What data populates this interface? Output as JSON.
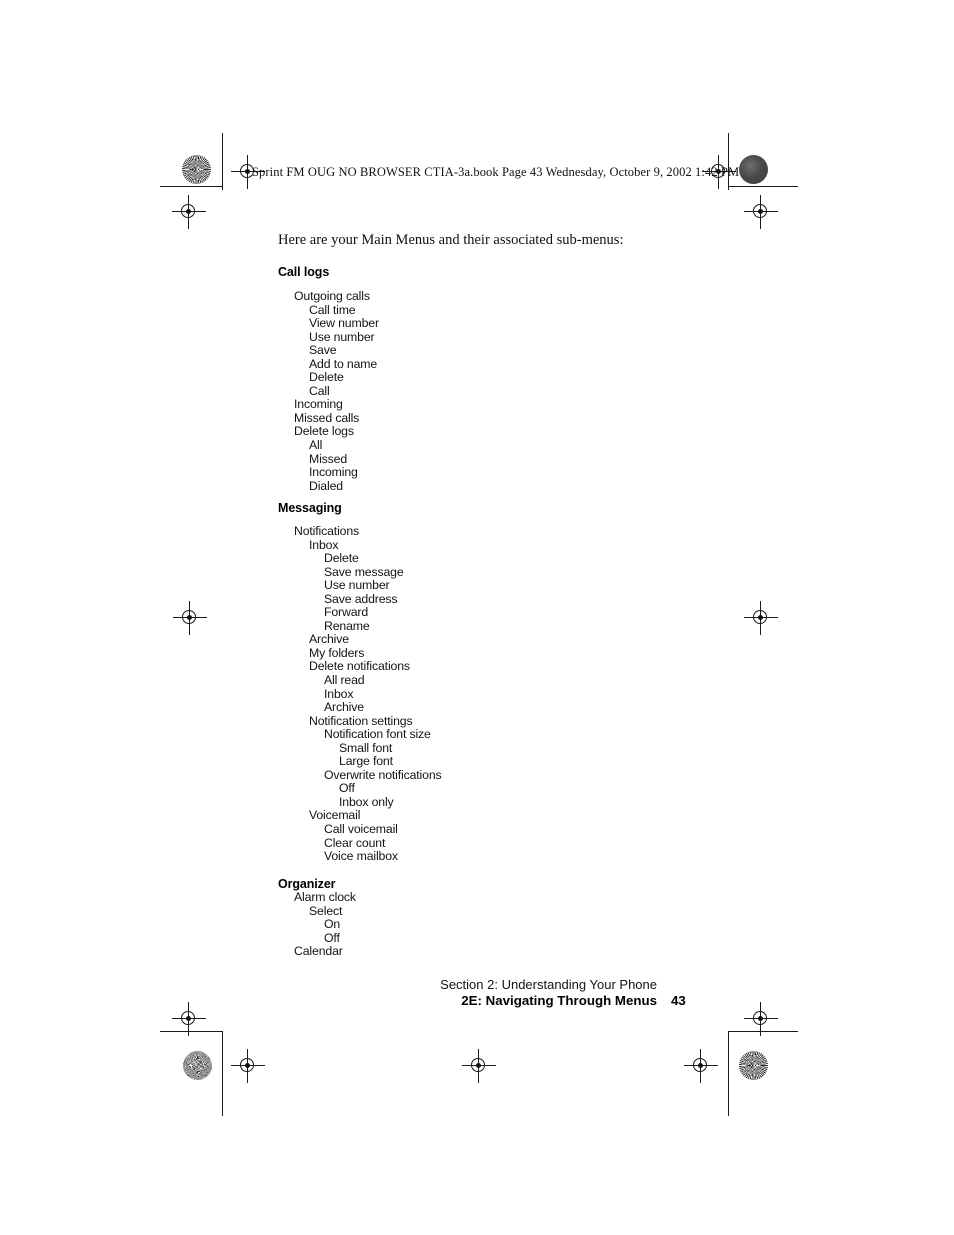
{
  "document": {
    "running_head": "Sprint FM OUG NO BROWSER CTIA-3a.book  Page 43  Wednesday, October 9, 2002  1:42 PM",
    "intro": "Here are your Main Menus and their associated sub-menus:",
    "page_number": "43"
  },
  "footer": {
    "section": "Section 2: Understanding Your Phone",
    "chapter": "2E: Navigating Through Menus",
    "page_number": "43"
  },
  "sections": [
    {
      "heading": "Call logs",
      "items": [
        {
          "label": "Outgoing calls",
          "level": 1
        },
        {
          "label": "Call time",
          "level": 2
        },
        {
          "label": "View number",
          "level": 2
        },
        {
          "label": "Use number",
          "level": 2
        },
        {
          "label": "Save",
          "level": 2
        },
        {
          "label": "Add to name",
          "level": 2
        },
        {
          "label": "Delete",
          "level": 2
        },
        {
          "label": "Call",
          "level": 2
        },
        {
          "label": "Incoming",
          "level": 1
        },
        {
          "label": "Missed calls",
          "level": 1
        },
        {
          "label": "Delete logs",
          "level": 1
        },
        {
          "label": "All",
          "level": 2
        },
        {
          "label": "Missed",
          "level": 2
        },
        {
          "label": "Incoming",
          "level": 2
        },
        {
          "label": "Dialed",
          "level": 2
        }
      ]
    },
    {
      "heading": "Messaging",
      "items": [
        {
          "label": "Notifications",
          "level": 1
        },
        {
          "label": "Inbox",
          "level": 2
        },
        {
          "label": "Delete",
          "level": 3
        },
        {
          "label": "Save message",
          "level": 3
        },
        {
          "label": "Use number",
          "level": 3
        },
        {
          "label": "Save address",
          "level": 3
        },
        {
          "label": "Forward",
          "level": 3
        },
        {
          "label": "Rename",
          "level": 3
        },
        {
          "label": "Archive",
          "level": 2
        },
        {
          "label": "My folders",
          "level": 2
        },
        {
          "label": "Delete notifications",
          "level": 2
        },
        {
          "label": "All read",
          "level": 3
        },
        {
          "label": "Inbox",
          "level": 3
        },
        {
          "label": "Archive",
          "level": 3
        },
        {
          "label": "Notification settings",
          "level": 2
        },
        {
          "label": "Notification font size",
          "level": 3
        },
        {
          "label": "Small font",
          "level": 4
        },
        {
          "label": "Large font",
          "level": 4
        },
        {
          "label": "Overwrite notifications",
          "level": 3
        },
        {
          "label": "Off",
          "level": 4
        },
        {
          "label": "Inbox only",
          "level": 4
        },
        {
          "label": "Voicemail",
          "level": 2
        },
        {
          "label": "Call voicemail",
          "level": 3
        },
        {
          "label": "Clear count",
          "level": 3
        },
        {
          "label": "Voice mailbox",
          "level": 3
        }
      ]
    },
    {
      "heading": "Organizer",
      "items": [
        {
          "label": "Alarm clock",
          "level": 1
        },
        {
          "label": "Select",
          "level": 2
        },
        {
          "label": "On",
          "level": 3
        },
        {
          "label": "Off",
          "level": 3
        },
        {
          "label": "Calendar",
          "level": 1
        }
      ]
    }
  ]
}
